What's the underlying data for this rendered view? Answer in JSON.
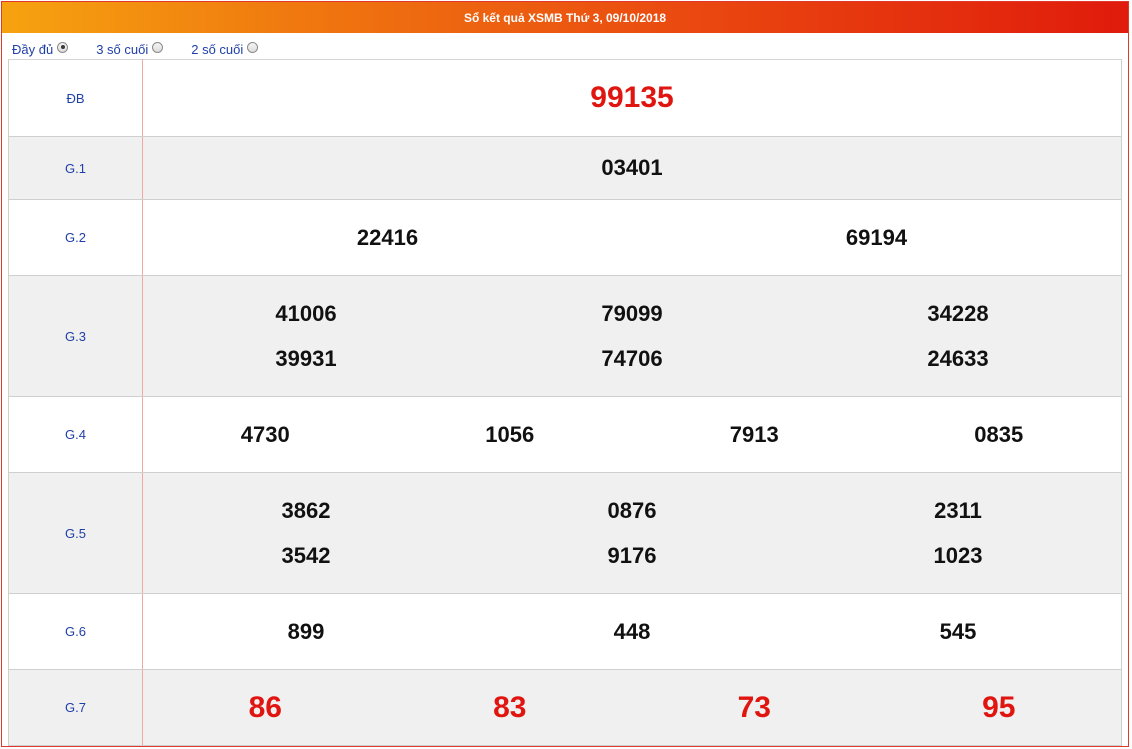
{
  "title": "Sổ kết quả XSMB Thứ 3, 09/10/2018",
  "options": [
    {
      "label": "Đầy đủ",
      "checked": true
    },
    {
      "label": "3 số cuối",
      "checked": false
    },
    {
      "label": "2 số cuối",
      "checked": false
    }
  ],
  "colors": {
    "accent": "#e01b0c",
    "highlight_number": "#e0150f",
    "label_blue": "#1f3fa8"
  },
  "prizes": [
    {
      "label": "ĐB",
      "numbers": [
        "99135"
      ]
    },
    {
      "label": "G.1",
      "numbers": [
        "03401"
      ]
    },
    {
      "label": "G.2",
      "numbers": [
        "22416",
        "69194"
      ]
    },
    {
      "label": "G.3",
      "numbers": [
        "41006",
        "79099",
        "34228",
        "39931",
        "74706",
        "24633"
      ]
    },
    {
      "label": "G.4",
      "numbers": [
        "4730",
        "1056",
        "7913",
        "0835"
      ]
    },
    {
      "label": "G.5",
      "numbers": [
        "3862",
        "0876",
        "2311",
        "3542",
        "9176",
        "1023"
      ]
    },
    {
      "label": "G.6",
      "numbers": [
        "899",
        "448",
        "545"
      ]
    },
    {
      "label": "G.7",
      "numbers": [
        "86",
        "83",
        "73",
        "95"
      ]
    }
  ]
}
